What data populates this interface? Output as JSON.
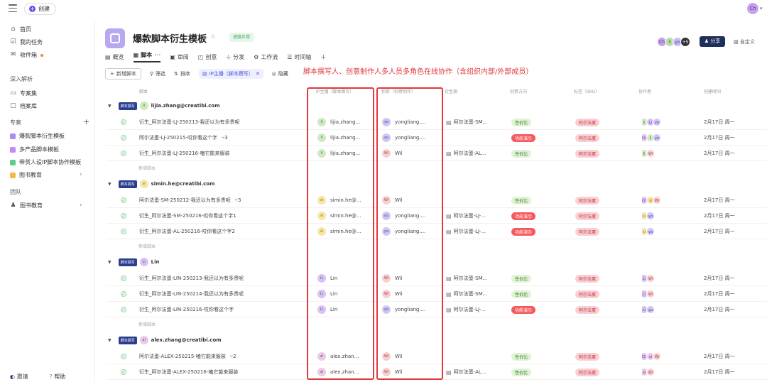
{
  "topbar": {
    "create_label": "创建",
    "avatar": "Ch"
  },
  "sidebar": {
    "nav": [
      "首页",
      "我的任务",
      "收件箱"
    ],
    "section_deep": "深入解析",
    "deep_items": [
      "专案集",
      "档案库"
    ],
    "section_projects": "专案",
    "projects": [
      {
        "label": "爆款脚本衍生模板",
        "color": "#a98cf0"
      },
      {
        "label": "多产品脚本模板",
        "color": "#c28af5"
      },
      {
        "label": "带货人设IP脚本协作模板",
        "color": "#5ccf8f"
      },
      {
        "label": "图书教育",
        "color": "#f5b84a"
      }
    ],
    "section_team": "团队",
    "team_item": "图书教育",
    "invite": "邀请",
    "help": "帮助"
  },
  "project": {
    "title": "爆款脚本衍生模板",
    "status": "进度正常",
    "tabs": [
      "概览",
      "脚本",
      "审阅",
      "创意",
      "分发",
      "工作流",
      "时间轴"
    ],
    "share": "分享",
    "custom": "自定义",
    "header_avatars": [
      {
        "t": "Ch",
        "bg": "#c7a3ee",
        "fg": "#5b2a8a"
      },
      {
        "t": "li",
        "bg": "#b8e0a8",
        "fg": "#356b22"
      },
      {
        "t": "yo",
        "bg": "#c9bdf5",
        "fg": "#4a3a9a"
      },
      {
        "t": "+5",
        "bg": "#333",
        "fg": "#fff"
      }
    ]
  },
  "toolbar": {
    "add": "新增脚本",
    "filter": "筛选",
    "sort": "排序",
    "chip": "IP主播（脚本撰写）",
    "hide": "隐藏"
  },
  "annotation": "脚本撰写人、创意制作人多人员多角色在线协作（含组织内部/外部成员）",
  "columns": [
    "脚本",
    "IP主播（脚本撰写）",
    "拍剪（创意制作）",
    "衍生源",
    "创意方向",
    "标签（SKU）",
    "协作者",
    "创建时间"
  ],
  "group_tag": "脚本撰写",
  "new_row_label": "新增脚本",
  "groups": [
    {
      "initials": "li",
      "name": "lijia.zhang@creatibi.com",
      "rows": [
        {
          "title": "衍生_阿尔法蛋-LJ-250213-我还以为有多贵呢",
          "sub": "",
          "ip": "lijia.zhang...",
          "ip_av": "li",
          "ed": "yongliang....",
          "ed_av": "yo",
          "src": "阿尔法蛋-SM...",
          "dir": "性价比",
          "dir_t": "g",
          "tag": "阿尔法蛋",
          "collab": [
            "li",
            "Li",
            "yo"
          ],
          "date": "2月17日 周一"
        },
        {
          "title": "阿尔法蛋-LJ-250215-哎你看这个字",
          "sub": "3",
          "ip": "lijia.zhang...",
          "ip_av": "li",
          "ed": "yongliang....",
          "ed_av": "yo",
          "src": "",
          "dir": "功能演示",
          "dir_t": "r",
          "tag": "阿尔法蛋",
          "collab": [
            "Ch",
            "li",
            "yo"
          ],
          "date": "2月17日 周一"
        },
        {
          "title": "衍生_阿尔法蛋-LJ-250216-嗑它能来服装",
          "sub": "",
          "ip": "lijia.zhang...",
          "ip_av": "li",
          "ed": "Wil",
          "ed_av": "Wi",
          "src": "阿尔法蛋-AL...",
          "dir": "性价比",
          "dir_t": "g",
          "tag": "阿尔法蛋",
          "collab": [
            "li",
            "Wi"
          ],
          "date": "2月17日 周一"
        }
      ]
    },
    {
      "initials": "si",
      "name": "simin.he@creatibi.com",
      "rows": [
        {
          "title": "阿尔法蛋-SM-250212-我还以为有多贵呢",
          "sub": "3",
          "ip": "simin.he@...",
          "ip_av": "si",
          "ed": "Wil",
          "ed_av": "Wi",
          "src": "",
          "dir": "性价比",
          "dir_t": "g",
          "tag": "阿尔法蛋",
          "collab": [
            "Ch",
            "si",
            "Wi"
          ],
          "date": "2月17日 周一"
        },
        {
          "title": "衍生_阿尔法蛋-SM-250216-哎你看这个字1",
          "sub": "",
          "ip": "simin.he@...",
          "ip_av": "si",
          "ed": "yongliang....",
          "ed_av": "yo",
          "src": "阿尔法蛋-LJ-...",
          "dir": "功能演示",
          "dir_t": "r",
          "tag": "阿尔法蛋",
          "collab": [
            "si",
            "yo"
          ],
          "date": "2月17日 周一"
        },
        {
          "title": "衍生_阿尔法蛋-AL-250216-哎你看这个字2",
          "sub": "",
          "ip": "simin.he@...",
          "ip_av": "si",
          "ed": "yongliang....",
          "ed_av": "yo",
          "src": "阿尔法蛋-LJ-...",
          "dir": "功能演示",
          "dir_t": "r",
          "tag": "阿尔法蛋",
          "collab": [
            "si",
            "yo"
          ],
          "date": "2月17日 周一"
        }
      ]
    },
    {
      "initials": "Li",
      "name": "Lin",
      "rows": [
        {
          "title": "衍生_阿尔法蛋-LIN-250213-我还以为有多贵呢",
          "sub": "",
          "ip": "Lin",
          "ip_av": "Li",
          "ed": "Wil",
          "ed_av": "Wi",
          "src": "阿尔法蛋-SM...",
          "dir": "性价比",
          "dir_t": "g",
          "tag": "阿尔法蛋",
          "collab": [
            "Li",
            "Wi"
          ],
          "date": "2月17日 周一"
        },
        {
          "title": "衍生_阿尔法蛋-LIN-250214-我还以为有多贵呢",
          "sub": "",
          "ip": "Lin",
          "ip_av": "Li",
          "ed": "Wil",
          "ed_av": "Wi",
          "src": "阿尔法蛋-SM...",
          "dir": "性价比",
          "dir_t": "g",
          "tag": "阿尔法蛋",
          "collab": [
            "Li",
            "Wi"
          ],
          "date": "2月17日 周一"
        },
        {
          "title": "衍生_阿尔法蛋-LIN-250216-哎你看这个字",
          "sub": "",
          "ip": "Lin",
          "ip_av": "Li",
          "ed": "yongliang....",
          "ed_av": "yo",
          "src": "阿尔法蛋-LJ-...",
          "dir": "功能演示",
          "dir_t": "r",
          "tag": "阿尔法蛋",
          "collab": [
            "Li",
            "yo"
          ],
          "date": "2月17日 周一"
        }
      ]
    },
    {
      "initials": "al",
      "name": "alex.zhang@creatibi.com",
      "rows": [
        {
          "title": "阿尔法蛋-ALEX-250215-嗑它能来服装",
          "sub": "2",
          "ip": "alex.zhan...",
          "ip_av": "al",
          "ed": "Wil",
          "ed_av": "Wi",
          "src": "",
          "dir": "性价比",
          "dir_t": "g",
          "tag": "阿尔法蛋",
          "collab": [
            "Ch",
            "al",
            "Wi"
          ],
          "date": "2月17日 周一"
        },
        {
          "title": "衍生_阿尔法蛋-ALEX-250216-嗑它能来服装",
          "sub": "",
          "ip": "alex.zhan...",
          "ip_av": "al",
          "ed": "Wil",
          "ed_av": "Wi",
          "src": "阿尔法蛋-AL...",
          "dir": "性价比",
          "dir_t": "g",
          "tag": "阿尔法蛋",
          "collab": [
            "al",
            "Wi"
          ],
          "date": "2月17日 周一"
        }
      ]
    }
  ],
  "avatar_colors": {
    "li": [
      "#cfe9c0",
      "#3c7a2a"
    ],
    "Li": [
      "#d7c2f3",
      "#6a3aa8"
    ],
    "yo": [
      "#cfc6f5",
      "#4b3ba0"
    ],
    "Ch": [
      "#e0c3f5",
      "#7b3aa8"
    ],
    "Wi": [
      "#f6cfd0",
      "#b83840"
    ],
    "si": [
      "#f6e6a6",
      "#8a6a10"
    ],
    "al": [
      "#e7cbe7",
      "#8a3a8a"
    ]
  }
}
